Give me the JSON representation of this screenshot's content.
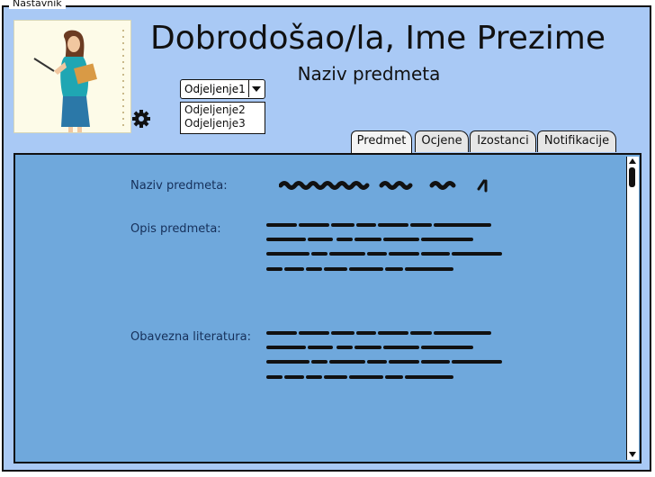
{
  "window": {
    "title": "Nastavnik"
  },
  "header": {
    "welcome": "Dobrodošao/la, Ime Prezime",
    "subject": "Naziv predmeta"
  },
  "icons": {
    "avatar": "teacher-avatar",
    "settings": "gear-icon"
  },
  "class_select": {
    "value": "Odjeljenje1",
    "options": [
      "Odjeljenje2",
      "Odjeljenje3"
    ]
  },
  "tabs": [
    {
      "label": "Predmet"
    },
    {
      "label": "Ocjene"
    },
    {
      "label": "Izostanci"
    },
    {
      "label": "Notifikacije"
    }
  ],
  "active_tab": "Predmet",
  "details": {
    "subject_label": "Naziv predmeta:",
    "description_label": "Opis predmeta:",
    "literature_label": "Obavezna literatura:"
  },
  "colors": {
    "frame_bg": "#a9c9f5",
    "panel_bg": "#6fa8dc"
  }
}
